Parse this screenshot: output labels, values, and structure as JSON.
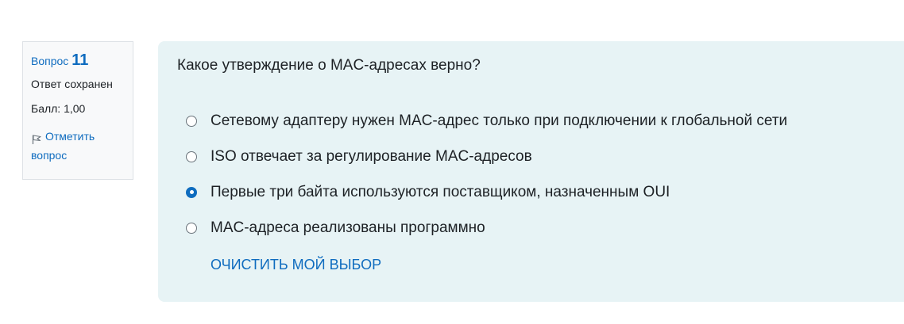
{
  "info": {
    "question_label": "Вопрос",
    "question_number": "11",
    "state": "Ответ сохранен",
    "grade": "Балл: 1,00",
    "flag_label": "Отметить вопрос",
    "flag_icon": "flag-icon"
  },
  "question": {
    "text": "Какое утверждение о MAC-адресах верно?",
    "answers": [
      {
        "label": "Сетевому адаптеру нужен MAC-адрес только при подключении к глобальной сети",
        "selected": false
      },
      {
        "label": "ISO отвечает за регулирование MAC-адресов",
        "selected": false
      },
      {
        "label": "Первые три байта используются поставщиком, назначенным OUI",
        "selected": true
      },
      {
        "label": "MAC-адреса реализованы программно",
        "selected": false
      }
    ],
    "clear_label": "ОЧИСТИТЬ МОЙ ВЫБОР"
  },
  "colors": {
    "accent": "#0f6cbf",
    "content_bg": "#e7f3f5",
    "info_bg": "#f8f9fa",
    "text": "#1d2125"
  }
}
